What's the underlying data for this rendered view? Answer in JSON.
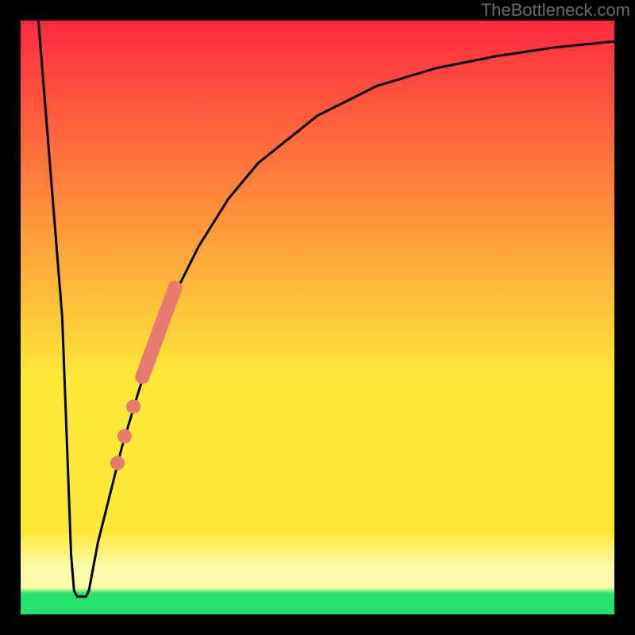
{
  "watermark": "TheBottleneck.com",
  "chart_data": {
    "type": "line",
    "title": "",
    "xlabel": "",
    "ylabel": "",
    "xlim": [
      0,
      100
    ],
    "ylim": [
      0,
      100
    ],
    "grid": false,
    "series": [
      {
        "name": "bottleneck-curve",
        "points": [
          {
            "x": 3,
            "y": 100
          },
          {
            "x": 7,
            "y": 50
          },
          {
            "x": 8.5,
            "y": 10
          },
          {
            "x": 9,
            "y": 4
          },
          {
            "x": 9.5,
            "y": 3
          },
          {
            "x": 11,
            "y": 3
          },
          {
            "x": 11.5,
            "y": 4
          },
          {
            "x": 13,
            "y": 12
          },
          {
            "x": 17,
            "y": 28
          },
          {
            "x": 20,
            "y": 38
          },
          {
            "x": 25,
            "y": 52
          },
          {
            "x": 30,
            "y": 62
          },
          {
            "x": 35,
            "y": 70
          },
          {
            "x": 40,
            "y": 76
          },
          {
            "x": 50,
            "y": 84
          },
          {
            "x": 60,
            "y": 89
          },
          {
            "x": 70,
            "y": 92
          },
          {
            "x": 80,
            "y": 94
          },
          {
            "x": 90,
            "y": 95.5
          },
          {
            "x": 100,
            "y": 96.5
          }
        ]
      },
      {
        "name": "highlighted-segment",
        "points": [
          {
            "x": 20.5,
            "y": 40
          },
          {
            "x": 26,
            "y": 55
          }
        ]
      },
      {
        "name": "highlighted-dots",
        "points": [
          {
            "x": 19,
            "y": 35
          },
          {
            "x": 17.5,
            "y": 30
          },
          {
            "x": 16.3,
            "y": 25.5
          }
        ]
      }
    ],
    "gradient_colors": {
      "top": "#ff2a3f",
      "yellow": "#ffe838",
      "pale_yellow": "#f9fba8",
      "green": "#26e26d"
    },
    "frame_color": "#000000",
    "curve_color": "#000000",
    "highlight_color": "#e87a6f"
  }
}
